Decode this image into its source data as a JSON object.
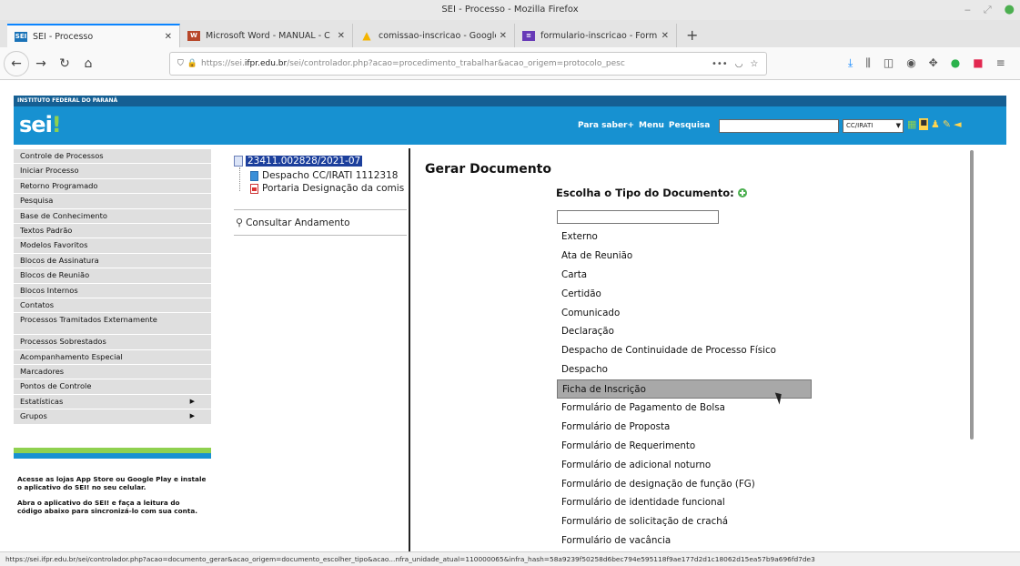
{
  "window": {
    "title": "SEI - Processo - Mozilla Firefox"
  },
  "tabs": [
    {
      "label": "SEI - Processo",
      "favicon": "sei"
    },
    {
      "label": "Microsoft Word - MANUAL - C",
      "favicon": "word"
    },
    {
      "label": "comissao-inscricao - Google D",
      "favicon": "drive"
    },
    {
      "label": "formulario-inscricao - Formu",
      "favicon": "forms"
    }
  ],
  "address": {
    "prefix": "https://sei.",
    "host": "ifpr.edu.br",
    "path": "/sei/controlador.php?acao=procedimento_trabalhar&acao_origem=protocolo_pesc"
  },
  "sei": {
    "institution": "INSTITUTO FEDERAL DO PARANÁ",
    "logo": "sei",
    "top_links": [
      "Para saber+",
      "Menu",
      "Pesquisa"
    ],
    "unit": "CC/IRATI"
  },
  "menu": {
    "items": [
      "Controle de Processos",
      "Iniciar Processo",
      "Retorno Programado",
      "Pesquisa",
      "Base de Conhecimento",
      "Textos Padrão",
      "Modelos Favoritos",
      "Blocos de Assinatura",
      "Blocos de Reunião",
      "Blocos Internos",
      "Contatos",
      "Processos Tramitados Externamente",
      "Processos Sobrestados",
      "Acompanhamento Especial",
      "Marcadores",
      "Pontos de Controle",
      "Estatísticas",
      "Grupos"
    ],
    "promo1": "Acesse as lojas App Store ou Google Play e instale o aplicativo do SEI! no seu celular.",
    "promo2": "Abra o aplicativo do SEI! e faça a leitura do código abaixo para sincronizá-lo com sua conta."
  },
  "tree": {
    "process_number": "23411.002828/2021-07",
    "docs": [
      "Despacho CC/IRATI 1112318",
      "Portaria Designação da comis"
    ],
    "consultar": "Consultar Andamento"
  },
  "main": {
    "title": "Gerar Documento",
    "subtitle": "Escolha o Tipo do Documento:",
    "doc_types": [
      "Externo",
      "Ata de Reunião",
      "Carta",
      "Certidão",
      "Comunicado",
      "Declaração",
      "Despacho de Continuidade de Processo Físico",
      "Despacho",
      "Ficha de Inscrição",
      "Formulário de Pagamento de Bolsa",
      "Formulário de Proposta",
      "Formulário de Requerimento",
      "Formulário de adicional noturno",
      "Formulário de designação de função (FG)",
      "Formulário de identidade funcional",
      "Formulário de solicitação de crachá",
      "Formulário de vacância"
    ],
    "highlighted": "Ficha de Inscrição"
  },
  "status": "https://sei.ifpr.edu.br/sei/controlador.php?acao=documento_gerar&acao_origem=documento_escolher_tipo&acao...nfra_unidade_atual=110000065&infra_hash=58a9239f50258d6bec794e595118f9ae177d2d1c18062d15ea57b9a696fd7de3"
}
